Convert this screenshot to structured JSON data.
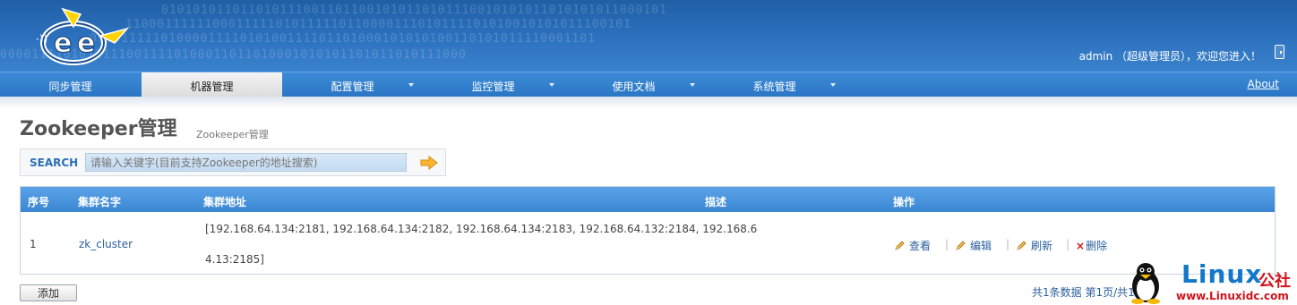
{
  "header": {
    "user_text": "admin （超级管理员），欢迎您进入！"
  },
  "nav": {
    "items": [
      {
        "label": "同步管理",
        "active": false,
        "dropdown": false
      },
      {
        "label": "机器管理",
        "active": true,
        "dropdown": false
      },
      {
        "label": "配置管理",
        "active": false,
        "dropdown": true
      },
      {
        "label": "监控管理",
        "active": false,
        "dropdown": true
      },
      {
        "label": "使用文档",
        "active": false,
        "dropdown": true
      },
      {
        "label": "系统管理",
        "active": false,
        "dropdown": true
      }
    ],
    "about": "About"
  },
  "page": {
    "title": "Zookeeper管理",
    "subtitle": "Zookeeper管理"
  },
  "search": {
    "label": "SEARCH",
    "placeholder": "请输入关键字(目前支持Zookeeper的地址搜索)"
  },
  "table": {
    "headers": [
      "序号",
      "集群名字",
      "集群地址",
      "描述",
      "操作"
    ],
    "rows": [
      {
        "index": "1",
        "name": "zk_cluster",
        "address_line1": "[192.168.64.134:2181, 192.168.64.134:2182, 192.168.64.134:2183, 192.168.64.132:2184, 192.168.6",
        "address_line2": "4.13:2185]",
        "description": "",
        "actions": {
          "view": "查看",
          "edit": "编辑",
          "refresh": "刷新",
          "delete": "删除"
        }
      }
    ]
  },
  "footer": {
    "add_label": "添加",
    "pager": "共1条数据  第1页/共1页"
  },
  "watermark": {
    "title": "Linux",
    "cn": "公社",
    "url": "www.Linuxidc.com"
  },
  "colors": {
    "header_blue": "#2d72bf",
    "nav_blue": "#2a76c5",
    "link_blue": "#2a5f9e",
    "delete_red": "#d01010"
  }
}
